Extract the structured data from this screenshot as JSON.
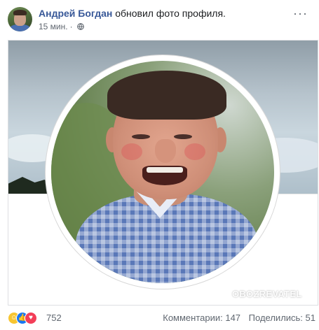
{
  "post": {
    "author": "Андрей Богдан",
    "action": "обновил фото профиля.",
    "time": "15 мин.",
    "more": "···"
  },
  "media": {
    "watermark": "OBOZREVATEL"
  },
  "icons": {
    "privacy": "globe-icon",
    "more": "more-options-icon",
    "reactions": [
      "haha-reaction-icon",
      "like-reaction-icon",
      "love-reaction-icon"
    ]
  },
  "footer": {
    "reaction_count": "752",
    "comments": "Комментарии: 147",
    "shares": "Поделились: 51"
  },
  "colors": {
    "author": "#385898",
    "meta": "#606770",
    "like": "#1877f2",
    "love": "#f33e58",
    "haha": "#f7c531"
  }
}
